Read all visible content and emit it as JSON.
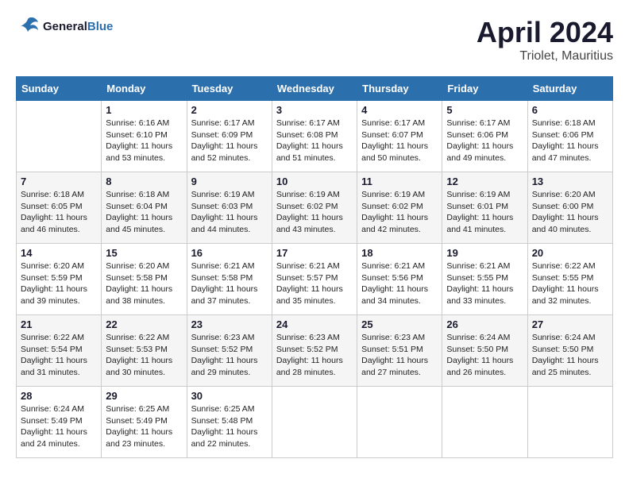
{
  "header": {
    "logo_line1": "General",
    "logo_line2": "Blue",
    "title": "April 2024",
    "subtitle": "Triolet, Mauritius"
  },
  "weekdays": [
    "Sunday",
    "Monday",
    "Tuesday",
    "Wednesday",
    "Thursday",
    "Friday",
    "Saturday"
  ],
  "weeks": [
    [
      {
        "day": "",
        "sunrise": "",
        "sunset": "",
        "daylight": ""
      },
      {
        "day": "1",
        "sunrise": "Sunrise: 6:16 AM",
        "sunset": "Sunset: 6:10 PM",
        "daylight": "Daylight: 11 hours and 53 minutes."
      },
      {
        "day": "2",
        "sunrise": "Sunrise: 6:17 AM",
        "sunset": "Sunset: 6:09 PM",
        "daylight": "Daylight: 11 hours and 52 minutes."
      },
      {
        "day": "3",
        "sunrise": "Sunrise: 6:17 AM",
        "sunset": "Sunset: 6:08 PM",
        "daylight": "Daylight: 11 hours and 51 minutes."
      },
      {
        "day": "4",
        "sunrise": "Sunrise: 6:17 AM",
        "sunset": "Sunset: 6:07 PM",
        "daylight": "Daylight: 11 hours and 50 minutes."
      },
      {
        "day": "5",
        "sunrise": "Sunrise: 6:17 AM",
        "sunset": "Sunset: 6:06 PM",
        "daylight": "Daylight: 11 hours and 49 minutes."
      },
      {
        "day": "6",
        "sunrise": "Sunrise: 6:18 AM",
        "sunset": "Sunset: 6:06 PM",
        "daylight": "Daylight: 11 hours and 47 minutes."
      }
    ],
    [
      {
        "day": "7",
        "sunrise": "Sunrise: 6:18 AM",
        "sunset": "Sunset: 6:05 PM",
        "daylight": "Daylight: 11 hours and 46 minutes."
      },
      {
        "day": "8",
        "sunrise": "Sunrise: 6:18 AM",
        "sunset": "Sunset: 6:04 PM",
        "daylight": "Daylight: 11 hours and 45 minutes."
      },
      {
        "day": "9",
        "sunrise": "Sunrise: 6:19 AM",
        "sunset": "Sunset: 6:03 PM",
        "daylight": "Daylight: 11 hours and 44 minutes."
      },
      {
        "day": "10",
        "sunrise": "Sunrise: 6:19 AM",
        "sunset": "Sunset: 6:02 PM",
        "daylight": "Daylight: 11 hours and 43 minutes."
      },
      {
        "day": "11",
        "sunrise": "Sunrise: 6:19 AM",
        "sunset": "Sunset: 6:02 PM",
        "daylight": "Daylight: 11 hours and 42 minutes."
      },
      {
        "day": "12",
        "sunrise": "Sunrise: 6:19 AM",
        "sunset": "Sunset: 6:01 PM",
        "daylight": "Daylight: 11 hours and 41 minutes."
      },
      {
        "day": "13",
        "sunrise": "Sunrise: 6:20 AM",
        "sunset": "Sunset: 6:00 PM",
        "daylight": "Daylight: 11 hours and 40 minutes."
      }
    ],
    [
      {
        "day": "14",
        "sunrise": "Sunrise: 6:20 AM",
        "sunset": "Sunset: 5:59 PM",
        "daylight": "Daylight: 11 hours and 39 minutes."
      },
      {
        "day": "15",
        "sunrise": "Sunrise: 6:20 AM",
        "sunset": "Sunset: 5:58 PM",
        "daylight": "Daylight: 11 hours and 38 minutes."
      },
      {
        "day": "16",
        "sunrise": "Sunrise: 6:21 AM",
        "sunset": "Sunset: 5:58 PM",
        "daylight": "Daylight: 11 hours and 37 minutes."
      },
      {
        "day": "17",
        "sunrise": "Sunrise: 6:21 AM",
        "sunset": "Sunset: 5:57 PM",
        "daylight": "Daylight: 11 hours and 35 minutes."
      },
      {
        "day": "18",
        "sunrise": "Sunrise: 6:21 AM",
        "sunset": "Sunset: 5:56 PM",
        "daylight": "Daylight: 11 hours and 34 minutes."
      },
      {
        "day": "19",
        "sunrise": "Sunrise: 6:21 AM",
        "sunset": "Sunset: 5:55 PM",
        "daylight": "Daylight: 11 hours and 33 minutes."
      },
      {
        "day": "20",
        "sunrise": "Sunrise: 6:22 AM",
        "sunset": "Sunset: 5:55 PM",
        "daylight": "Daylight: 11 hours and 32 minutes."
      }
    ],
    [
      {
        "day": "21",
        "sunrise": "Sunrise: 6:22 AM",
        "sunset": "Sunset: 5:54 PM",
        "daylight": "Daylight: 11 hours and 31 minutes."
      },
      {
        "day": "22",
        "sunrise": "Sunrise: 6:22 AM",
        "sunset": "Sunset: 5:53 PM",
        "daylight": "Daylight: 11 hours and 30 minutes."
      },
      {
        "day": "23",
        "sunrise": "Sunrise: 6:23 AM",
        "sunset": "Sunset: 5:52 PM",
        "daylight": "Daylight: 11 hours and 29 minutes."
      },
      {
        "day": "24",
        "sunrise": "Sunrise: 6:23 AM",
        "sunset": "Sunset: 5:52 PM",
        "daylight": "Daylight: 11 hours and 28 minutes."
      },
      {
        "day": "25",
        "sunrise": "Sunrise: 6:23 AM",
        "sunset": "Sunset: 5:51 PM",
        "daylight": "Daylight: 11 hours and 27 minutes."
      },
      {
        "day": "26",
        "sunrise": "Sunrise: 6:24 AM",
        "sunset": "Sunset: 5:50 PM",
        "daylight": "Daylight: 11 hours and 26 minutes."
      },
      {
        "day": "27",
        "sunrise": "Sunrise: 6:24 AM",
        "sunset": "Sunset: 5:50 PM",
        "daylight": "Daylight: 11 hours and 25 minutes."
      }
    ],
    [
      {
        "day": "28",
        "sunrise": "Sunrise: 6:24 AM",
        "sunset": "Sunset: 5:49 PM",
        "daylight": "Daylight: 11 hours and 24 minutes."
      },
      {
        "day": "29",
        "sunrise": "Sunrise: 6:25 AM",
        "sunset": "Sunset: 5:49 PM",
        "daylight": "Daylight: 11 hours and 23 minutes."
      },
      {
        "day": "30",
        "sunrise": "Sunrise: 6:25 AM",
        "sunset": "Sunset: 5:48 PM",
        "daylight": "Daylight: 11 hours and 22 minutes."
      },
      {
        "day": "",
        "sunrise": "",
        "sunset": "",
        "daylight": ""
      },
      {
        "day": "",
        "sunrise": "",
        "sunset": "",
        "daylight": ""
      },
      {
        "day": "",
        "sunrise": "",
        "sunset": "",
        "daylight": ""
      },
      {
        "day": "",
        "sunrise": "",
        "sunset": "",
        "daylight": ""
      }
    ]
  ]
}
